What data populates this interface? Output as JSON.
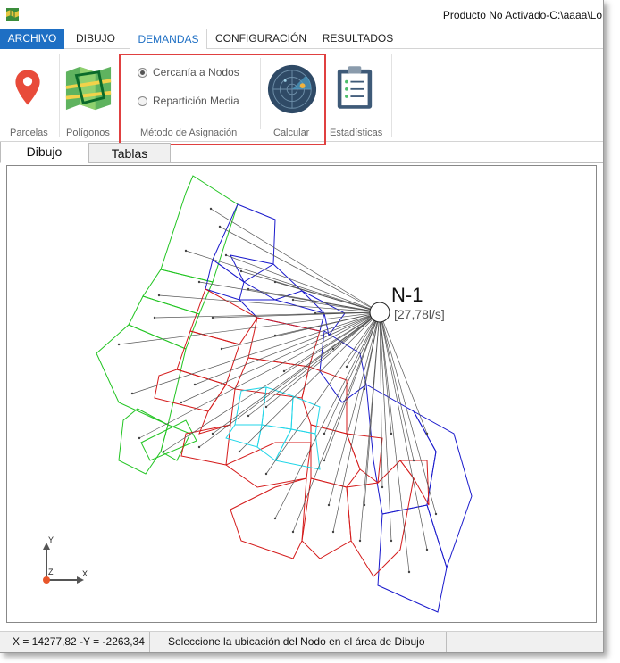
{
  "window": {
    "title": "Producto No Activado-C:\\aaaa\\Lo"
  },
  "ribbon_tabs": [
    {
      "label": "ARCHIVO"
    },
    {
      "label": "DIBUJO"
    },
    {
      "label": "DEMANDAS"
    },
    {
      "label": "CONFIGURACIÓN"
    },
    {
      "label": "RESULTADOS"
    }
  ],
  "ribbon": {
    "parcelas": {
      "label": "Parcelas",
      "icon": "map-pin-icon"
    },
    "poligonos": {
      "label": "Polígonos",
      "icon": "map-polygon-icon"
    },
    "metodo": {
      "group_label": "Método de Asignación",
      "options": [
        {
          "label": "Cercanía a Nodos",
          "selected": true
        },
        {
          "label": "Repartición Media",
          "selected": false
        }
      ]
    },
    "calcular": {
      "label": "Calcular",
      "icon": "radar-icon"
    },
    "estadisticas": {
      "label": "Estadísticas",
      "icon": "clipboard-icon"
    }
  },
  "doc_tabs": [
    {
      "label": "Dibujo"
    },
    {
      "label": "Tablas"
    }
  ],
  "drawing": {
    "node_name": "N-1",
    "node_flow": "[27,78l/s]",
    "axis_y": "Y",
    "axis_z": "Z",
    "axis_x": "X",
    "colors": {
      "green": "#22c422",
      "blue": "#1a1acc",
      "red": "#d41a1a",
      "cyan": "#22d6e8",
      "connector": "#555555"
    }
  },
  "status": {
    "coords": "X = 14277,82 -Y = -2263,34",
    "message": "Seleccione la ubicación del Nodo en el área de Dibujo"
  }
}
